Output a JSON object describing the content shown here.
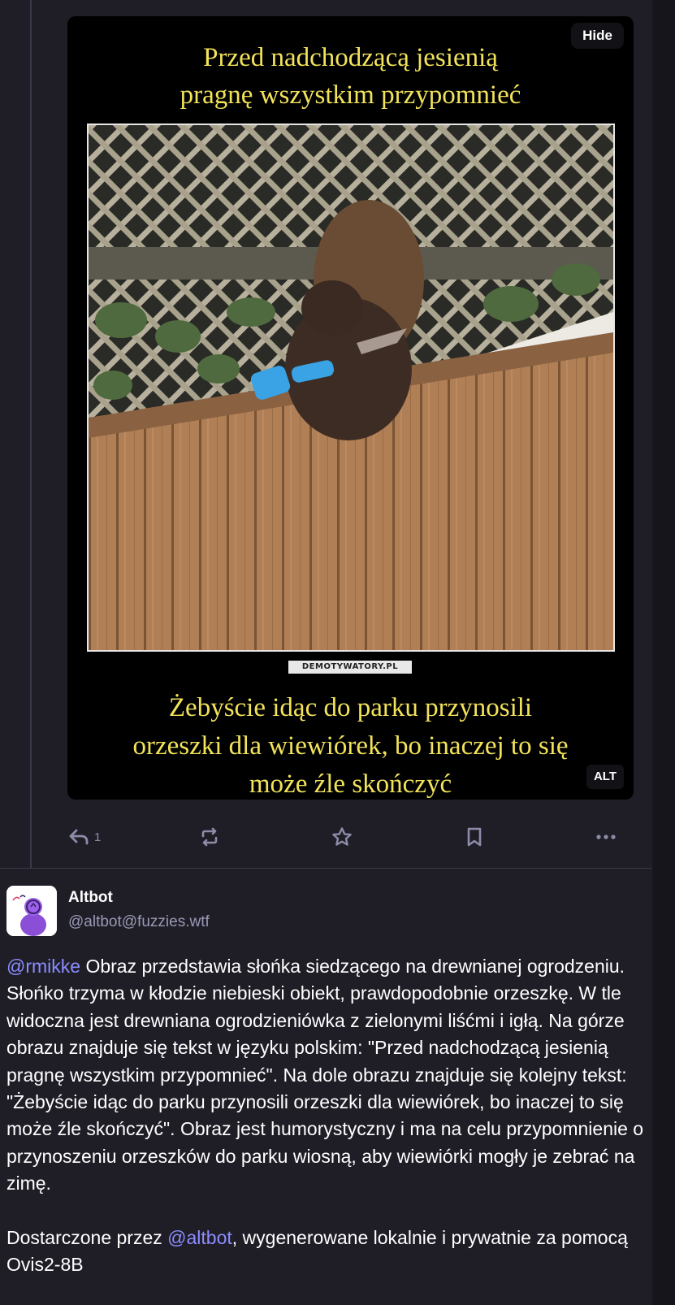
{
  "media": {
    "top_caption": [
      "Przed nadchodzącą jesienią",
      "pragnę wszystkim przypomnieć"
    ],
    "watermark": "DEMOTYWATORY.PL",
    "bottom_caption": [
      "Żebyście idąc do parku przynosili",
      "orzeszki dla wiewiórek, bo inaczej to się",
      "może źle skończyć"
    ],
    "hide_label": "Hide",
    "alt_label": "ALT"
  },
  "actions": {
    "reply_icon": "reply-icon",
    "reply_count": "1",
    "boost_icon": "boost-icon",
    "favourite_icon": "star-icon",
    "bookmark_icon": "bookmark-icon",
    "more_icon": "more-icon",
    "color": "#8d8ca8"
  },
  "reply_post": {
    "display_name": "Altbot",
    "handle": "@altbot@fuzzies.wtf",
    "avatar_icon": "altbot-avatar",
    "mention": "@rmikke",
    "body": " Obraz przedstawia słońka siedzącego na drewnianej ogrodzeniu. Słońko trzyma w kłodzie niebieski obiekt, prawdopodobnie orzeszkę. W tle widoczna jest drewniana ogrodzieniówka z zielonymi liśćmi i igłą. Na górze obrazu znajduje się tekst w języku polskim: \"Przed nadchodzącą jesienią pragnę wszystkim przypomnieć\". Na dole obrazu znajduje się kolejny tekst: \"Żebyście idąc do parku przynosili orzeszki dla wiewiórek, bo inaczej to się może źle skończyć\". Obraz jest humorystyczny i ma na celu przypomnienie o przynoszeniu orzeszków do parku wiosną, aby wiewiórki mogły je zebrać na zimę.",
    "footer_prefix": "Dostarczone przez ",
    "footer_mention": "@altbot",
    "footer_suffix": ", wygenerowane lokalnie i prywatnie za pomocą Ovis2-8B"
  },
  "colors": {
    "background": "#1f1e27",
    "caption": "#f2e35a",
    "mention": "#8c8dff",
    "muted": "#9a99b6"
  }
}
